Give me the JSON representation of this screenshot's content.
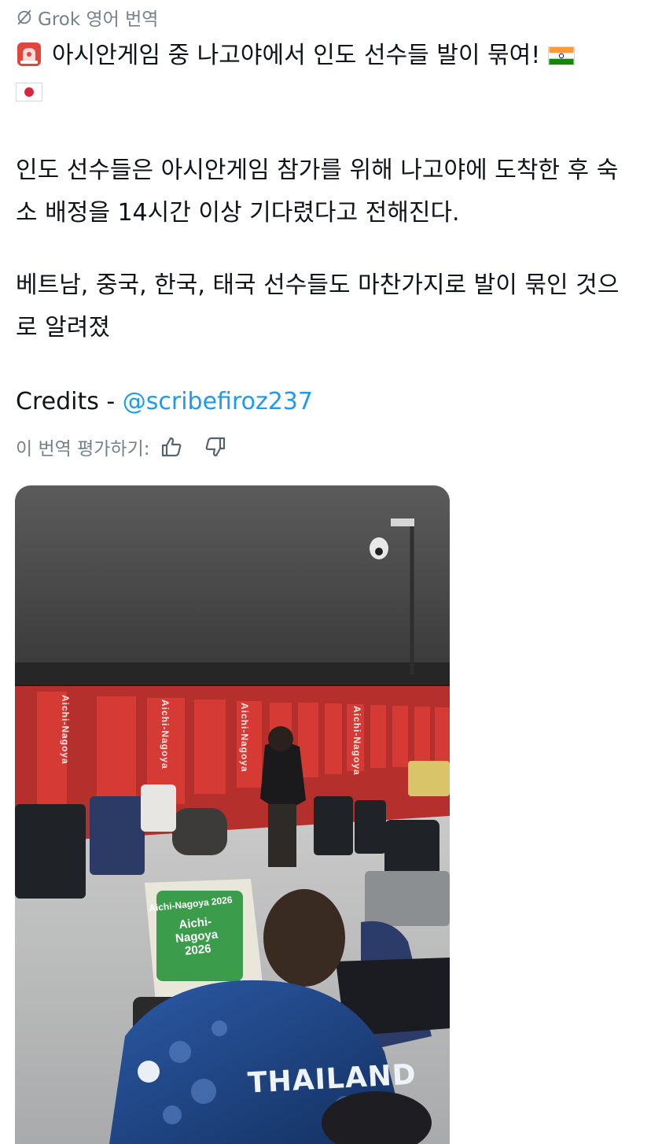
{
  "header": {
    "label": "Grok 영어 번역",
    "icon": "grok-icon"
  },
  "post": {
    "title": "아시안게임 중 나고야에서 인도 선수들 발이 묶여!",
    "paragraph1": "인도 선수들은 아시안게임 참가를 위해 나고야에 도착한 후 숙소 배정을 14시간 이상 기다렸다고 전해진다.",
    "paragraph2": "베트남, 중국, 한국, 태국 선수들도 마찬가지로 발이 묶인 것으로 알려졌",
    "credits_prefix": "Credits - ",
    "credits_handle": "@scribefiroz237"
  },
  "rating": {
    "label": "이 번역 평가하기:",
    "like_icon": "thumbs-up-icon",
    "dislike_icon": "thumbs-down-icon"
  },
  "media": {
    "jersey_text": "THAILAND",
    "sign_line1": "Aichi-Nagoya 2026",
    "sign_line2": "Aichi-\nNagoya\n2026",
    "wall_text": "Aichi-Nagoya"
  },
  "colors": {
    "link": "#1d9bf0",
    "muted": "#75818c",
    "text": "#0f1419",
    "wall_red": "#c8312c"
  }
}
